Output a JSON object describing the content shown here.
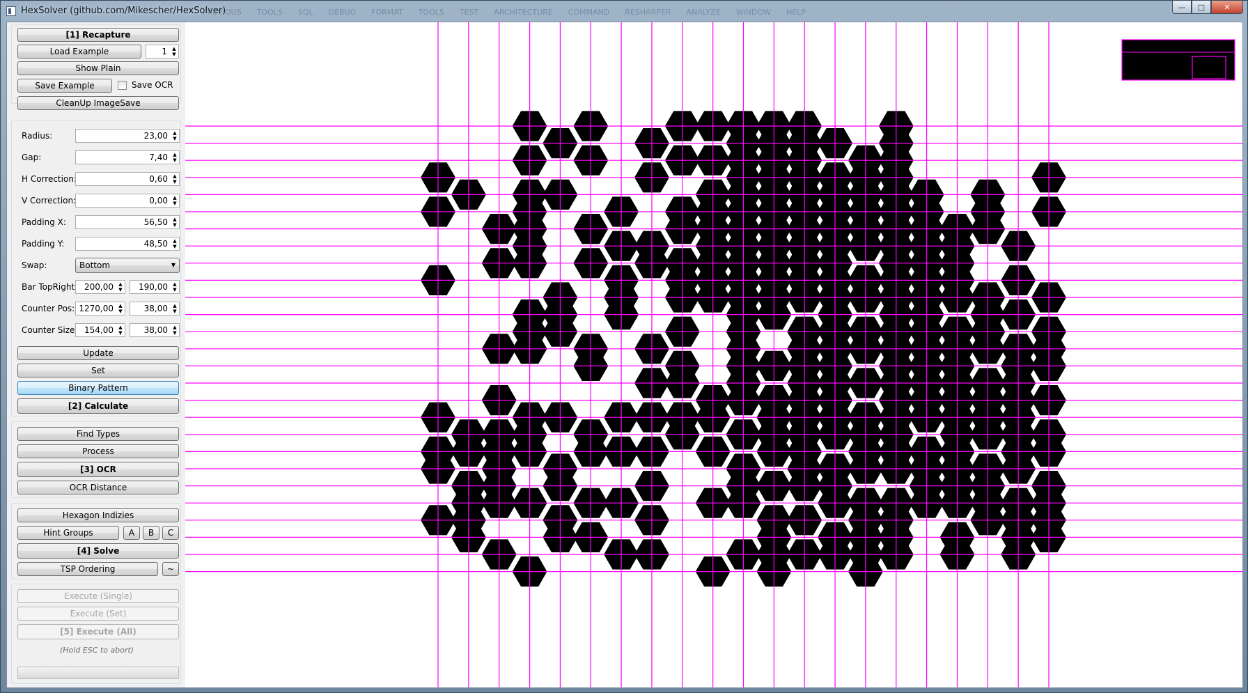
{
  "window": {
    "title": "HexSolver (github.com/Mikescher/HexSolver)",
    "ghost_menu": [
      "PREVIOUS",
      "TOOLS",
      "SQL",
      "DEBUG",
      "FORMAT",
      "TOOLS",
      "TEST",
      "ARCHITECTURE",
      "COMMAND",
      "RESHARPER",
      "ANALYZE",
      "WINDOW",
      "HELP"
    ],
    "buttons": {
      "minimize": "—",
      "maximize": "□",
      "close": "✕"
    }
  },
  "panel": {
    "group1": {
      "recapture": "[1] Recapture",
      "load_example": "Load Example",
      "example_number": "1",
      "show_plain": "Show Plain",
      "save_example": "Save Example",
      "save_ocr_label": "Save OCR",
      "save_ocr_checked": false,
      "cleanup": "CleanUp ImageSave"
    },
    "params": {
      "radius_label": "Radius:",
      "radius": "23,00",
      "gap_label": "Gap:",
      "gap": "7,40",
      "hcorr_label": "H Correction:",
      "hcorr": "0,60",
      "vcorr_label": "V Correction:",
      "vcorr": "0,00",
      "padx_label": "Padding X:",
      "padx": "56,50",
      "pady_label": "Padding Y:",
      "pady": "48,50",
      "swap_label": "Swap:",
      "swap": "Bottom",
      "bar_label": "Bar TopRight:",
      "bar_x": "200,00",
      "bar_y": "190,00",
      "counter_pos_label": "Counter Pos:",
      "counter_pos_x": "1270,00",
      "counter_pos_y": "38,00",
      "counter_size_label": "Counter Size:",
      "counter_size_x": "154,00",
      "counter_size_y": "38,00",
      "update": "Update",
      "set": "Set",
      "binary_pattern": "Binary Pattern",
      "calculate": "[2] Calculate"
    },
    "group3": {
      "find_types": "Find Types",
      "process": "Process",
      "ocr": "[3] OCR",
      "ocr_distance": "OCR Distance"
    },
    "group4": {
      "hexagon_indizies": "Hexagon Indizies",
      "hint_groups": "Hint Groups",
      "hint_a": "A",
      "hint_b": "B",
      "hint_c": "C",
      "solve": "[4] Solve",
      "tsp_ordering": "TSP Ordering",
      "tsp_more": "~"
    },
    "group5": {
      "execute_single": "Execute (Single)",
      "execute_set": "Execute (Set)",
      "execute_all": "[5] Execute (All)",
      "hold_esc": "(Hold ESC to abort)",
      "progress": 0
    }
  },
  "grid": {
    "line_color": "#ff00ff",
    "hex_color": "#000000",
    "columns": 21,
    "rows": 27,
    "cells": [
      [
        0,
        3
      ],
      [
        0,
        5
      ],
      [
        0,
        9
      ],
      [
        0,
        17
      ],
      [
        0,
        19
      ],
      [
        0,
        20
      ],
      [
        0,
        23
      ],
      [
        1,
        4
      ],
      [
        1,
        18
      ],
      [
        1,
        19
      ],
      [
        1,
        21
      ],
      [
        1,
        22
      ],
      [
        1,
        23
      ],
      [
        1,
        24
      ],
      [
        2,
        6
      ],
      [
        2,
        8
      ],
      [
        2,
        13
      ],
      [
        2,
        16
      ],
      [
        2,
        18
      ],
      [
        2,
        19
      ],
      [
        2,
        20
      ],
      [
        2,
        21
      ],
      [
        2,
        22
      ],
      [
        2,
        25
      ],
      [
        3,
        0
      ],
      [
        3,
        2
      ],
      [
        3,
        4
      ],
      [
        3,
        5
      ],
      [
        3,
        6
      ],
      [
        3,
        7
      ],
      [
        3,
        8
      ],
      [
        3,
        11
      ],
      [
        3,
        12
      ],
      [
        3,
        13
      ],
      [
        3,
        17
      ],
      [
        3,
        18
      ],
      [
        3,
        19
      ],
      [
        3,
        22
      ],
      [
        3,
        26
      ],
      [
        4,
        1
      ],
      [
        4,
        4
      ],
      [
        4,
        10
      ],
      [
        4,
        11
      ],
      [
        4,
        12
      ],
      [
        4,
        17
      ],
      [
        4,
        20
      ],
      [
        4,
        21
      ],
      [
        4,
        23
      ],
      [
        4,
        24
      ],
      [
        5,
        0
      ],
      [
        5,
        2
      ],
      [
        5,
        6
      ],
      [
        5,
        8
      ],
      [
        5,
        13
      ],
      [
        5,
        14
      ],
      [
        5,
        18
      ],
      [
        5,
        19
      ],
      [
        5,
        22
      ],
      [
        5,
        24
      ],
      [
        6,
        5
      ],
      [
        6,
        7
      ],
      [
        6,
        9
      ],
      [
        6,
        10
      ],
      [
        6,
        11
      ],
      [
        6,
        17
      ],
      [
        6,
        19
      ],
      [
        6,
        22
      ],
      [
        6,
        25
      ],
      [
        7,
        1
      ],
      [
        7,
        3
      ],
      [
        7,
        7
      ],
      [
        7,
        8
      ],
      [
        7,
        13
      ],
      [
        7,
        15
      ],
      [
        7,
        17
      ],
      [
        7,
        19
      ],
      [
        7,
        21
      ],
      [
        7,
        23
      ],
      [
        7,
        25
      ],
      [
        8,
        0
      ],
      [
        8,
        2
      ],
      [
        8,
        5
      ],
      [
        8,
        6
      ],
      [
        8,
        8
      ],
      [
        8,
        9
      ],
      [
        8,
        10
      ],
      [
        8,
        12
      ],
      [
        8,
        14
      ],
      [
        8,
        15
      ],
      [
        8,
        17
      ],
      [
        8,
        18
      ],
      [
        9,
        0
      ],
      [
        9,
        2
      ],
      [
        9,
        4
      ],
      [
        9,
        5
      ],
      [
        9,
        6
      ],
      [
        9,
        7
      ],
      [
        9,
        8
      ],
      [
        9,
        9
      ],
      [
        9,
        10
      ],
      [
        9,
        16
      ],
      [
        9,
        17
      ],
      [
        9,
        19
      ],
      [
        9,
        22
      ],
      [
        9,
        26
      ],
      [
        10,
        0
      ],
      [
        10,
        1
      ],
      [
        10,
        2
      ],
      [
        10,
        3
      ],
      [
        10,
        4
      ],
      [
        10,
        5
      ],
      [
        10,
        6
      ],
      [
        10,
        7
      ],
      [
        10,
        8
      ],
      [
        10,
        9
      ],
      [
        10,
        10
      ],
      [
        10,
        11
      ],
      [
        10,
        12
      ],
      [
        10,
        13
      ],
      [
        10,
        14
      ],
      [
        10,
        15
      ],
      [
        10,
        16
      ],
      [
        10,
        18
      ],
      [
        10,
        20
      ],
      [
        10,
        21
      ],
      [
        10,
        22
      ],
      [
        10,
        25
      ],
      [
        11,
        0
      ],
      [
        11,
        1
      ],
      [
        11,
        2
      ],
      [
        11,
        3
      ],
      [
        11,
        4
      ],
      [
        11,
        5
      ],
      [
        11,
        6
      ],
      [
        11,
        7
      ],
      [
        11,
        8
      ],
      [
        11,
        9
      ],
      [
        11,
        10
      ],
      [
        11,
        11
      ],
      [
        11,
        14
      ],
      [
        11,
        16
      ],
      [
        11,
        17
      ],
      [
        11,
        18
      ],
      [
        11,
        19
      ],
      [
        11,
        21
      ],
      [
        11,
        23
      ],
      [
        11,
        24
      ],
      [
        11,
        25
      ],
      [
        11,
        26
      ],
      [
        12,
        0
      ],
      [
        12,
        1
      ],
      [
        12,
        2
      ],
      [
        12,
        3
      ],
      [
        12,
        4
      ],
      [
        12,
        5
      ],
      [
        12,
        6
      ],
      [
        12,
        7
      ],
      [
        12,
        8
      ],
      [
        12,
        9
      ],
      [
        12,
        10
      ],
      [
        12,
        12
      ],
      [
        12,
        13
      ],
      [
        12,
        14
      ],
      [
        12,
        15
      ],
      [
        12,
        16
      ],
      [
        12,
        17
      ],
      [
        12,
        18
      ],
      [
        12,
        19
      ],
      [
        12,
        20
      ],
      [
        12,
        21
      ],
      [
        12,
        23
      ],
      [
        12,
        25
      ],
      [
        13,
        1
      ],
      [
        13,
        3
      ],
      [
        13,
        4
      ],
      [
        13,
        5
      ],
      [
        13,
        6
      ],
      [
        13,
        7
      ],
      [
        13,
        8
      ],
      [
        13,
        9
      ],
      [
        13,
        10
      ],
      [
        13,
        11
      ],
      [
        13,
        12
      ],
      [
        13,
        13
      ],
      [
        13,
        14
      ],
      [
        13,
        15
      ],
      [
        13,
        16
      ],
      [
        13,
        17
      ],
      [
        13,
        18
      ],
      [
        13,
        20
      ],
      [
        13,
        21
      ],
      [
        13,
        22
      ],
      [
        13,
        24
      ],
      [
        13,
        25
      ],
      [
        14,
        2
      ],
      [
        14,
        3
      ],
      [
        14,
        4
      ],
      [
        14,
        5
      ],
      [
        14,
        6
      ],
      [
        14,
        7
      ],
      [
        14,
        9
      ],
      [
        14,
        10
      ],
      [
        14,
        12
      ],
      [
        14,
        13
      ],
      [
        14,
        15
      ],
      [
        14,
        17
      ],
      [
        14,
        18
      ],
      [
        14,
        19
      ],
      [
        14,
        20
      ],
      [
        14,
        22
      ],
      [
        14,
        23
      ],
      [
        14,
        24
      ],
      [
        14,
        25
      ],
      [
        14,
        26
      ],
      [
        15,
        0
      ],
      [
        15,
        1
      ],
      [
        15,
        2
      ],
      [
        15,
        3
      ],
      [
        15,
        4
      ],
      [
        15,
        5
      ],
      [
        15,
        6
      ],
      [
        15,
        7
      ],
      [
        15,
        8
      ],
      [
        15,
        9
      ],
      [
        15,
        10
      ],
      [
        15,
        11
      ],
      [
        15,
        12
      ],
      [
        15,
        13
      ],
      [
        15,
        14
      ],
      [
        15,
        15
      ],
      [
        15,
        16
      ],
      [
        15,
        17
      ],
      [
        15,
        18
      ],
      [
        15,
        19
      ],
      [
        15,
        20
      ],
      [
        15,
        22
      ],
      [
        15,
        23
      ],
      [
        15,
        24
      ],
      [
        15,
        25
      ],
      [
        16,
        4
      ],
      [
        16,
        5
      ],
      [
        16,
        6
      ],
      [
        16,
        7
      ],
      [
        16,
        8
      ],
      [
        16,
        9
      ],
      [
        16,
        10
      ],
      [
        16,
        11
      ],
      [
        16,
        12
      ],
      [
        16,
        13
      ],
      [
        16,
        14
      ],
      [
        16,
        15
      ],
      [
        16,
        16
      ],
      [
        16,
        17
      ],
      [
        16,
        19
      ],
      [
        16,
        20
      ],
      [
        16,
        21
      ],
      [
        16,
        22
      ],
      [
        17,
        6
      ],
      [
        17,
        7
      ],
      [
        17,
        8
      ],
      [
        17,
        9
      ],
      [
        17,
        10
      ],
      [
        17,
        12
      ],
      [
        17,
        13
      ],
      [
        17,
        14
      ],
      [
        17,
        15
      ],
      [
        17,
        16
      ],
      [
        17,
        17
      ],
      [
        17,
        18
      ],
      [
        17,
        19
      ],
      [
        17,
        20
      ],
      [
        17,
        21
      ],
      [
        17,
        22
      ],
      [
        17,
        24
      ],
      [
        17,
        25
      ],
      [
        18,
        4
      ],
      [
        18,
        5
      ],
      [
        18,
        6
      ],
      [
        18,
        10
      ],
      [
        18,
        11
      ],
      [
        18,
        12
      ],
      [
        18,
        13
      ],
      [
        18,
        15
      ],
      [
        18,
        16
      ],
      [
        18,
        17
      ],
      [
        18,
        18
      ],
      [
        18,
        20
      ],
      [
        18,
        21
      ],
      [
        18,
        22
      ],
      [
        18,
        23
      ],
      [
        19,
        7
      ],
      [
        19,
        9
      ],
      [
        19,
        11
      ],
      [
        19,
        13
      ],
      [
        19,
        14
      ],
      [
        19,
        15
      ],
      [
        19,
        16
      ],
      [
        19,
        17
      ],
      [
        19,
        18
      ],
      [
        19,
        19
      ],
      [
        19,
        20
      ],
      [
        19,
        22
      ],
      [
        19,
        23
      ],
      [
        19,
        24
      ],
      [
        19,
        25
      ],
      [
        20,
        3
      ],
      [
        20,
        5
      ],
      [
        20,
        10
      ],
      [
        20,
        12
      ],
      [
        20,
        13
      ],
      [
        20,
        14
      ],
      [
        20,
        16
      ],
      [
        20,
        18
      ],
      [
        20,
        19
      ],
      [
        20,
        21
      ],
      [
        20,
        22
      ],
      [
        20,
        23
      ],
      [
        20,
        24
      ]
    ]
  },
  "counter_box": {
    "outline_color": "#ff00ff"
  }
}
